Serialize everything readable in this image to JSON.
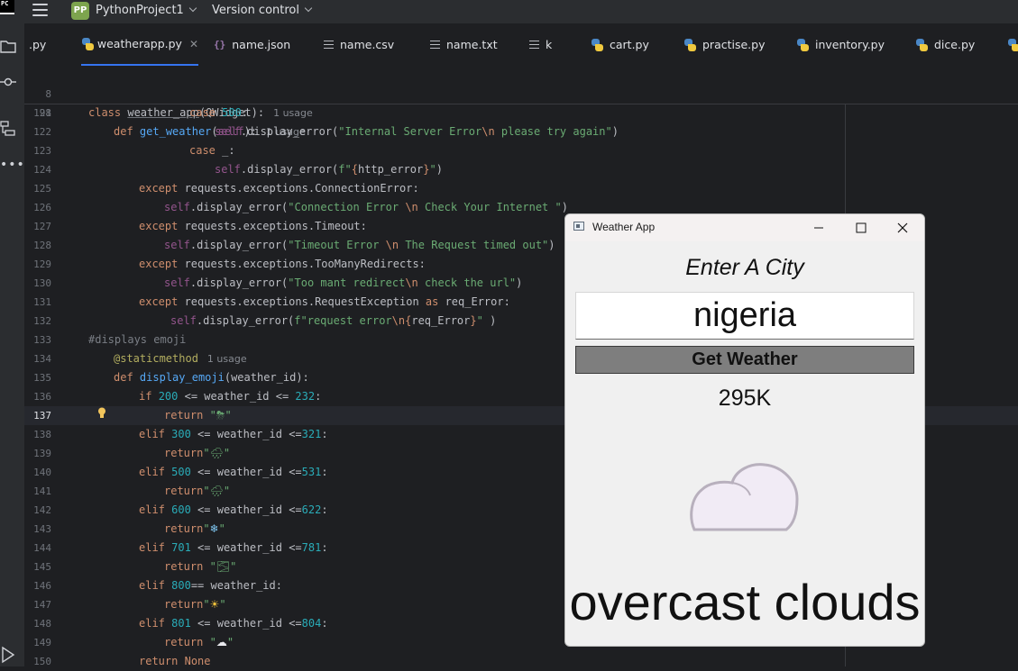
{
  "topbar": {
    "logo_text": "PC",
    "project_badge": "PP",
    "project_name": "PythonProject1",
    "version_control": "Version control"
  },
  "tabs": [
    {
      "label": ".py",
      "icon": "none"
    },
    {
      "label": "weatherapp.py",
      "icon": "python-file-icon",
      "active": true
    },
    {
      "label": "name.json",
      "icon": "json-file-icon"
    },
    {
      "label": "name.csv",
      "icon": "text-file-icon"
    },
    {
      "label": "name.txt",
      "icon": "text-file-icon"
    },
    {
      "label": "k",
      "icon": "text-file-icon"
    },
    {
      "label": "cart.py",
      "icon": "python-file-icon"
    },
    {
      "label": "practise.py",
      "icon": "python-file-icon"
    },
    {
      "label": "inventory.py",
      "icon": "python-file-icon"
    },
    {
      "label": "dice.py",
      "icon": "python-file-icon"
    }
  ],
  "editor": {
    "sticky": {
      "line8": "8",
      "line8_kw": "class",
      "line8_name": "weather_app",
      "line8_rest": "(QWidget):",
      "line8_hint": "1 usage",
      "line98": "98",
      "line98_kw": "def",
      "line98_name": "get_weather",
      "line98_self": "self",
      "line98_hint": "1 usage"
    },
    "line_numbers": [
      "121",
      "122",
      "123",
      "124",
      "125",
      "126",
      "127",
      "128",
      "129",
      "130",
      "131",
      "132",
      "133",
      "134",
      "135",
      "136",
      "137",
      "138",
      "139",
      "140",
      "141",
      "142",
      "143",
      "144",
      "145",
      "146",
      "147",
      "148",
      "149",
      "150"
    ],
    "strings": {
      "s122": "\"Internal Server Error",
      "s122b": " please try again\"",
      "s126": "\"Connection Error ",
      "s126b": " Check Your Internet \"",
      "s128": "\"Timeout Error ",
      "s128b": " The Request timed out\"",
      "s130": "\"Too mant redirect",
      "s130b": " check the url\"",
      "s132": "f\"request error",
      "s132b": "\"",
      "s124": "f\"",
      "s124b": "\"",
      "esc": "\\n",
      "comment": "#displays emoji",
      "decorator": "@staticmethod",
      "deco_hint": "1 usage",
      "e_thunder": "⛈",
      "e_rain": "🌧",
      "e_shower": "🌧",
      "e_snow": "❄",
      "e_fog": "🌫",
      "e_sun": "☀",
      "e_cloud": "☁"
    }
  },
  "weather_window": {
    "title": "Weather App",
    "prompt": "Enter A City",
    "city_value": "nigeria",
    "button_label": "Get Weather",
    "temperature": "295K",
    "description": "overcast clouds",
    "emoji_icon": "cloud-icon"
  },
  "colors": {
    "accent": "#3574f0",
    "editor_bg": "#1e1f22",
    "window_bg": "#f0f0f0",
    "button_bg": "#7e7e7e"
  }
}
